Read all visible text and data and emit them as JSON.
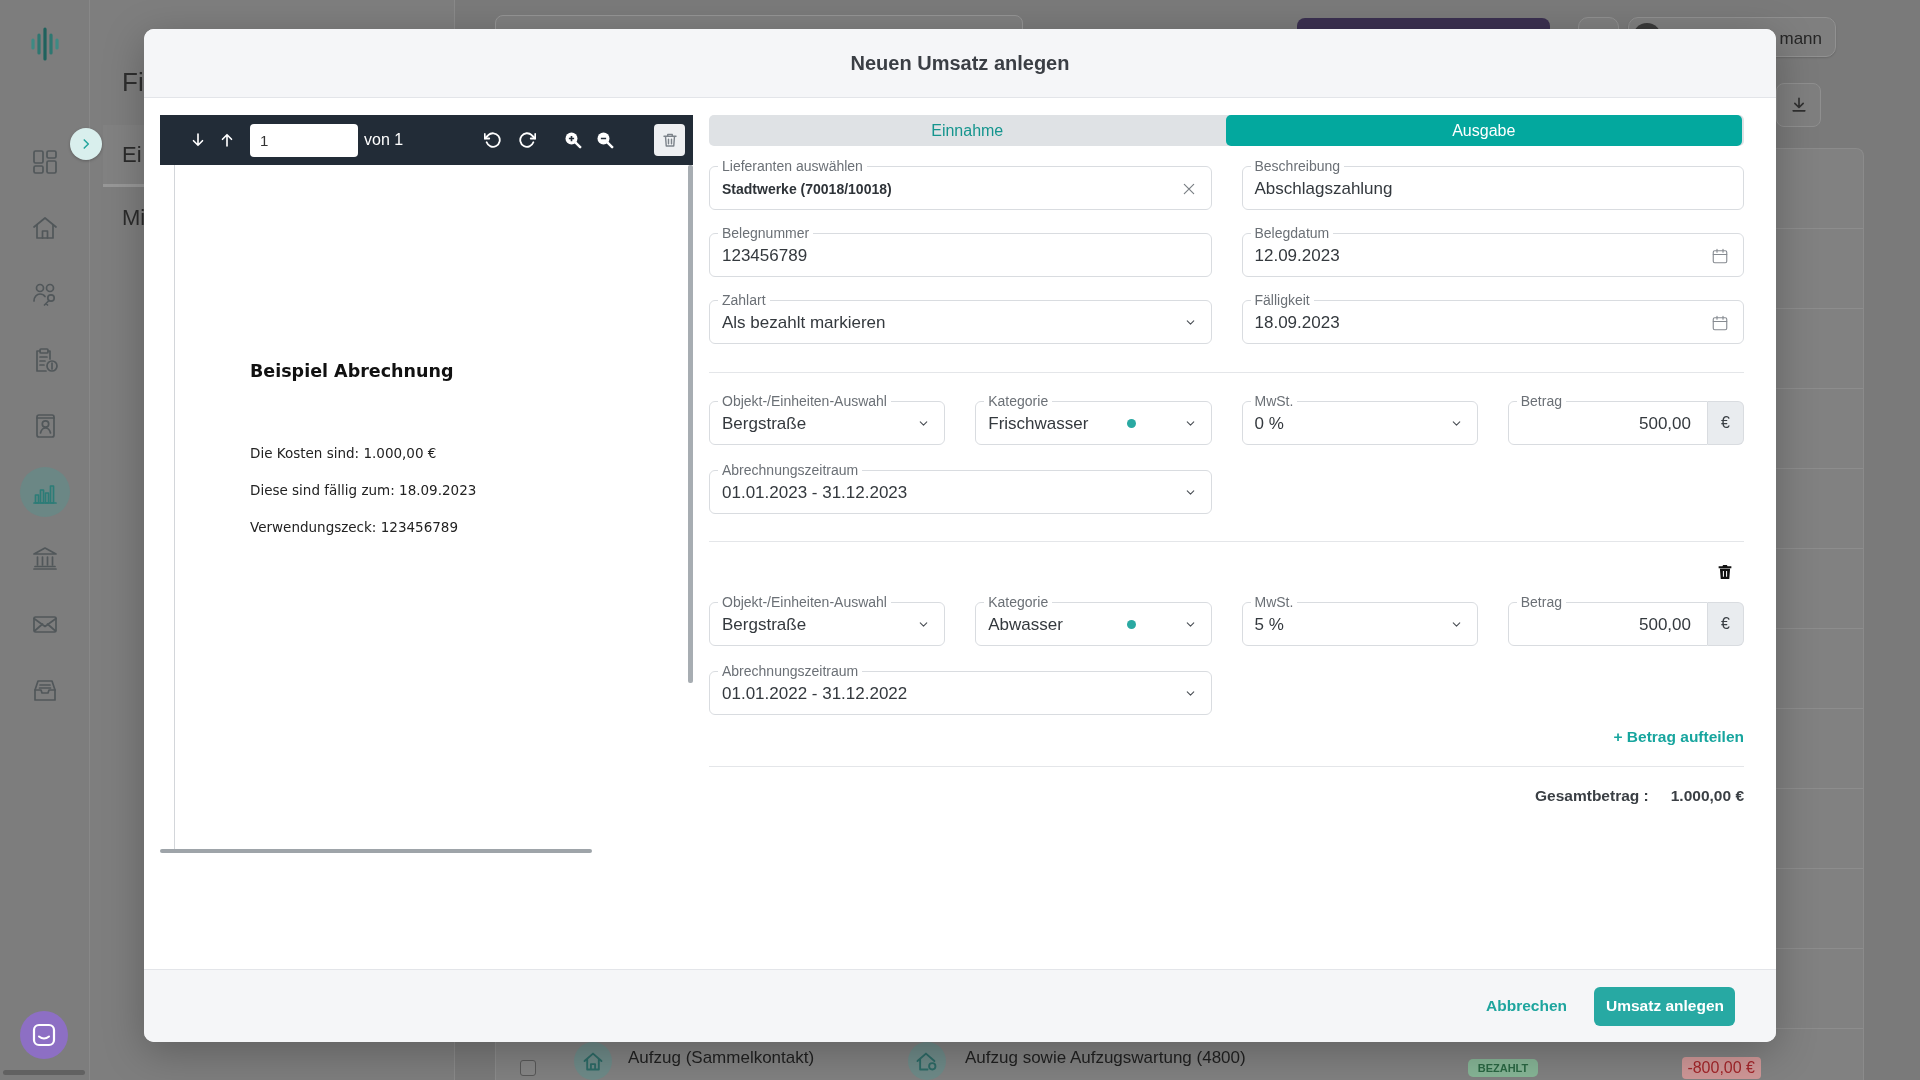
{
  "background": {
    "sidebar": {
      "items": [
        {
          "selected": false
        },
        {
          "selected": false
        },
        {
          "selected": false
        },
        {
          "selected": false
        },
        {
          "selected": false
        },
        {
          "selected": true
        },
        {
          "selected": false
        },
        {
          "selected": false
        },
        {
          "selected": false
        }
      ]
    },
    "panel": {
      "title": "Fi",
      "tabs": [
        {
          "label": "Ei",
          "selected": true
        },
        {
          "label": "Mi",
          "selected": false
        }
      ]
    },
    "topbar": {
      "user_name": "mann"
    },
    "table": {
      "rows": [
        {
          "checked": false,
          "name": "Aufzug (Sammelkontakt)",
          "account": "Aufzug sowie Aufzugswartung (4800)",
          "status": "BEZAHLT",
          "amount": "-800,00 €"
        }
      ]
    }
  },
  "dialog": {
    "title": "Neuen Umsatz anlegen",
    "viewer": {
      "page": "1",
      "page_count": "von 1",
      "document": {
        "heading": "Beispiel Abrechnung",
        "lines": [
          "Die Kosten sind: 1.000,00 €",
          "Diese sind fällig zum: 18.09.2023",
          "Verwendungszeck: 123456789"
        ]
      }
    },
    "tabs": [
      {
        "label": "Einnahme",
        "selected": false
      },
      {
        "label": "Ausgabe",
        "selected": true
      }
    ],
    "fields": [
      {
        "kind": "clearable",
        "label": "Lieferanten auswählen",
        "value": "Stadtwerke (70018/10018)"
      },
      {
        "kind": "text",
        "label": "Beschreibung",
        "value": "Abschlagszahlung"
      },
      {
        "kind": "text",
        "label": "Belegnummer",
        "value": "123456789"
      },
      {
        "kind": "date",
        "label": "Belegdatum",
        "value": "12.09.2023"
      },
      {
        "kind": "select",
        "label": "Zahlart",
        "value": "Als bezahlt markieren"
      },
      {
        "kind": "date",
        "label": "Fälligkeit",
        "value": "18.09.2023"
      }
    ],
    "splits": [
      {
        "deletable": false,
        "object": {
          "label": "Objekt-/Einheiten-Auswahl",
          "value": "Bergstraße"
        },
        "category": {
          "label": "Kategorie",
          "value": "Frischwasser"
        },
        "vat": {
          "label": "MwSt.",
          "value": "0 %"
        },
        "amount": {
          "label": "Betrag",
          "value": "500,00",
          "currency": "€"
        },
        "period": {
          "label": "Abrechnungszeitraum",
          "value": "01.01.2023 - 31.12.2023"
        }
      },
      {
        "deletable": true,
        "object": {
          "label": "Objekt-/Einheiten-Auswahl",
          "value": "Bergstraße"
        },
        "category": {
          "label": "Kategorie",
          "value": "Abwasser"
        },
        "vat": {
          "label": "MwSt.",
          "value": "5 %"
        },
        "amount": {
          "label": "Betrag",
          "value": "500,00",
          "currency": "€"
        },
        "period": {
          "label": "Abrechnungszeitraum",
          "value": "01.01.2022 - 31.12.2022"
        }
      }
    ],
    "split_action": "+ Betrag aufteilen",
    "total": {
      "label": "Gesamtbetrag :",
      "value": "1.000,00 €"
    },
    "buttons": [
      {
        "kind": "link",
        "label": "Abbrechen"
      },
      {
        "kind": "primary",
        "label": "Umsatz anlegen"
      }
    ]
  }
}
